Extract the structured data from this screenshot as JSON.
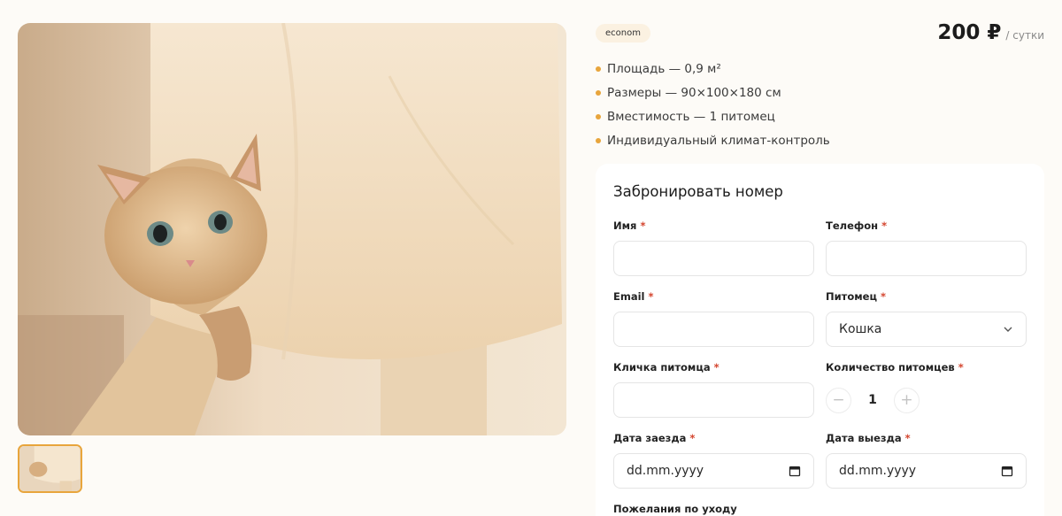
{
  "gallery": {
    "main_image": "cat-photo",
    "thumbnails": [
      {
        "image": "cat-photo",
        "selected": true
      }
    ]
  },
  "room": {
    "class_badge": "econom",
    "price": "200 ₽",
    "price_unit": "/ сутки",
    "features": [
      "Площадь — 0,9 м²",
      "Размеры — 90×100×180 см",
      "Вместимость — 1 питомец",
      "Индивидуальный климат-контроль"
    ]
  },
  "booking": {
    "title": "Забронировать номер",
    "required_mark": "*",
    "name_label": "Имя",
    "name_value": "",
    "phone_label": "Телефон",
    "phone_value": "",
    "email_label": "Email",
    "email_value": "",
    "pet_label": "Питомец",
    "pet_selected": "Кошка",
    "pet_name_label": "Кличка питомца",
    "pet_name_value": "",
    "pet_count_label": "Количество питомцев",
    "pet_count_value": "1",
    "decrement_symbol": "−",
    "increment_symbol": "+",
    "checkin_label": "Дата заезда",
    "checkin_placeholder": "dd.mm.yyyy",
    "checkout_label": "Дата выезда",
    "checkout_placeholder": "dd.mm.yyyy",
    "care_label": "Пожелания по уходу"
  },
  "colors": {
    "accent": "#e8a53c",
    "required": "#d4452e",
    "background": "#fdfbf7",
    "badge_bg": "#fbf1e1"
  }
}
